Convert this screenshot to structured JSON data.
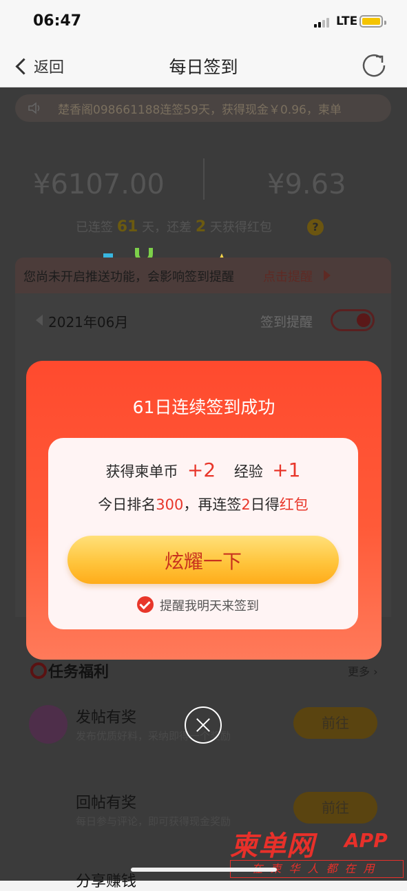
{
  "status_bar": {
    "time": "06:47",
    "network": "LTE"
  },
  "nav": {
    "back_label": "返回",
    "title": "每日签到"
  },
  "background": {
    "marquee": "楚香阁098661188连签59天，获得现金￥0.96，柬单",
    "stat_left": "¥6107.00",
    "stat_right": "¥9.63",
    "streak_prefix": "已连签",
    "streak_days": "61",
    "streak_mid": "天，还差",
    "streak_need": "2",
    "streak_suffix": "天获得红包",
    "push_notice": "您尚未开启推送功能，会影响签到提醒",
    "push_link": "点击提醒",
    "month": "2021年06月",
    "remind_label": "签到提醒",
    "tasks_title": "任务福利",
    "more": "更多",
    "tasks": [
      {
        "name": "发帖有奖",
        "desc": "发布优质好料，采纳即得一个奖励",
        "button": "前往"
      },
      {
        "name": "回帖有奖",
        "desc": "每日参与评论，即可获得现金奖励",
        "button": "前往"
      },
      {
        "name": "分享赚钱"
      }
    ]
  },
  "popup": {
    "title": "61日连续签到成功",
    "reward_prefix": "获得柬单币",
    "reward_coins": "+2",
    "reward_exp_label": "经验",
    "reward_exp": "+1",
    "rank_prefix": "今日排名",
    "rank_value": "300",
    "rank_mid": "，再连签",
    "rank_days": "2",
    "rank_mid2": "日得",
    "rank_reward": "红包",
    "share_button": "炫耀一下",
    "remind_checkbox": "提醒我明天来签到",
    "remind_checked": true
  },
  "watermark": {
    "main": "柬单网",
    "app": "APP",
    "sub": "在柬华人都在用"
  },
  "colors": {
    "accent_red": "#e8362a",
    "popup_top": "#ff4a2e",
    "button_yellow": "#ffc53d"
  }
}
